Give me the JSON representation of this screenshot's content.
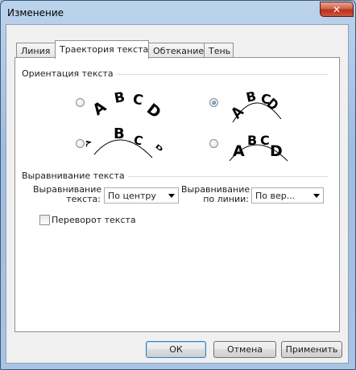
{
  "window": {
    "title": "Изменение",
    "close_glyph": "✕"
  },
  "tabs": [
    {
      "label": "Линия",
      "active": false
    },
    {
      "label": "Траектория текста",
      "active": true
    },
    {
      "label": "Обтекание",
      "active": false
    },
    {
      "label": "Тень",
      "active": false
    }
  ],
  "orientation": {
    "label": "Ориентация текста",
    "selected_index": 1,
    "sample_letters": [
      "A",
      "B",
      "C",
      "D"
    ]
  },
  "alignment": {
    "label": "Выравнивание текста",
    "text_align_label_line1": "Выравнивание",
    "text_align_label_line2": "текста:",
    "text_align_value": "По центру",
    "line_align_label_line1": "Выравнивание",
    "line_align_label_line2": "по линии:",
    "line_align_value": "По вер..."
  },
  "flip": {
    "label": "Переворот текста",
    "checked": false
  },
  "buttons": {
    "ok": "ОК",
    "cancel": "Отмена",
    "apply": "Применить"
  }
}
